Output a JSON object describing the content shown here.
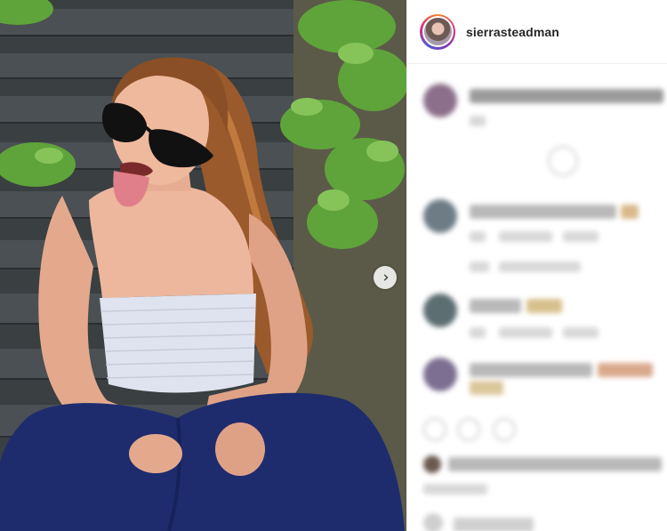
{
  "post": {
    "username": "sierrasteadman",
    "avatar_icon": "profile-avatar",
    "carousel_next_icon": "chevron-right-icon",
    "carousel_next_glyph": "›"
  },
  "colors": {
    "text_primary": "#262626",
    "divider": "#efefef",
    "story_ring": [
      "#f58529",
      "#dd2a7b",
      "#8134af",
      "#515bd4"
    ]
  }
}
